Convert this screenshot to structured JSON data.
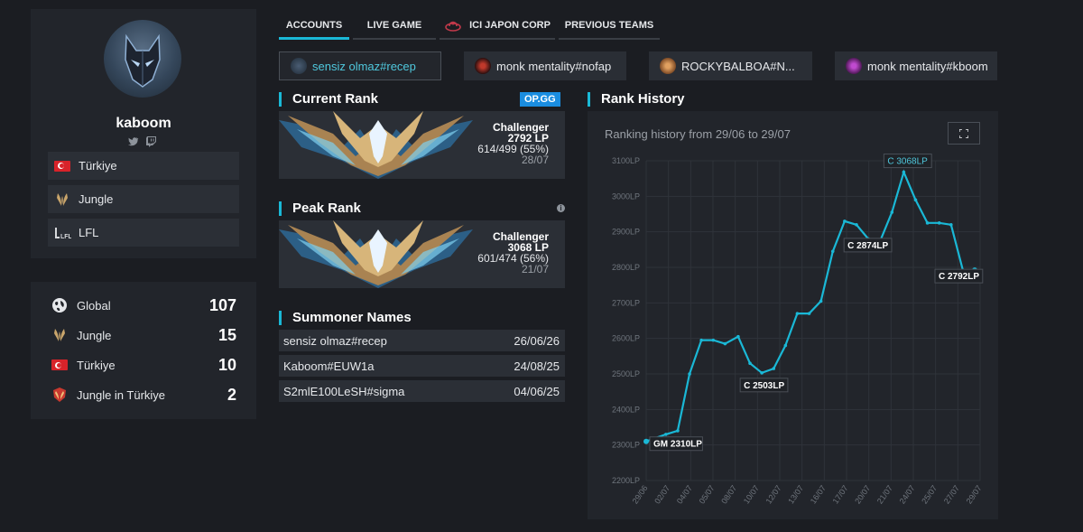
{
  "profile": {
    "name": "kaboom",
    "socials": [
      "twitter-icon",
      "twitch-icon"
    ],
    "info": [
      {
        "icon": "turkey-flag-icon",
        "label": "Türkiye"
      },
      {
        "icon": "jungle-role-icon",
        "label": "Jungle"
      },
      {
        "icon": "lfl-league-icon",
        "label": "LFL"
      }
    ]
  },
  "rankings": [
    {
      "icon": "globe-icon",
      "label": "Global",
      "value": "107"
    },
    {
      "icon": "jungle-role-icon",
      "label": "Jungle",
      "value": "15"
    },
    {
      "icon": "turkey-flag-icon",
      "label": "Türkiye",
      "value": "10"
    },
    {
      "icon": "jungle-turkey-crest-icon",
      "label": "Jungle in Türkiye",
      "value": "2"
    }
  ],
  "tabs": [
    "ACCOUNTS",
    "LIVE GAME",
    "ICI JAPON CORP",
    "PREVIOUS TEAMS"
  ],
  "accounts": [
    "sensiz olmaz#recep",
    "monk mentality#nofap",
    "ROCKYBALBOA#N...",
    "monk mentality#kboom"
  ],
  "colors": {
    "accent": "#1ab8d6",
    "opgg": "#1a8de0",
    "line": "#1ab8d6"
  },
  "current_rank": {
    "heading": "Current Rank",
    "badge": "OP.GG",
    "tier": "Challenger",
    "lp": "2792 LP",
    "record": "614/499 (55%)",
    "date": "28/07"
  },
  "peak_rank": {
    "heading": "Peak Rank",
    "tier": "Challenger",
    "lp": "3068 LP",
    "record": "601/474 (56%)",
    "date": "21/07"
  },
  "summoner_names": {
    "heading": "Summoner Names",
    "rows": [
      {
        "name": "sensiz olmaz#recep",
        "date": "26/06/26"
      },
      {
        "name": "Kaboom#EUW1a",
        "date": "24/08/25"
      },
      {
        "name": "S2mlE100LeSH#sigma",
        "date": "04/06/25"
      }
    ]
  },
  "rank_history": {
    "heading": "Rank History",
    "subtitle": "Ranking history from 29/06 to 29/07"
  },
  "chart_data": {
    "type": "line",
    "y_tick_labels": [
      "3100LP",
      "3000LP",
      "2900LP",
      "2800LP",
      "2700LP",
      "2600LP",
      "2500LP",
      "2400LP",
      "2300LP",
      "2200LP"
    ],
    "ylim": [
      2200,
      3100
    ],
    "x_tick_labels": [
      "29/06",
      "02/07",
      "04/07",
      "05/07",
      "08/07",
      "10/07",
      "12/07",
      "13/07",
      "16/07",
      "17/07",
      "20/07",
      "21/07",
      "24/07",
      "25/07",
      "27/07",
      "29/07"
    ],
    "grid": true,
    "series": [
      {
        "values": [
          [
            0,
            2310
          ],
          [
            1.5,
            2330
          ],
          [
            2.4,
            2340
          ],
          [
            3.3,
            2500
          ],
          [
            4.2,
            2595
          ],
          [
            5.1,
            2595
          ],
          [
            6.0,
            2585
          ],
          [
            7.0,
            2605
          ],
          [
            7.9,
            2530
          ],
          [
            8.8,
            2503
          ],
          [
            9.7,
            2515
          ],
          [
            10.6,
            2580
          ],
          [
            11.5,
            2670
          ],
          [
            12.4,
            2670
          ],
          [
            13.3,
            2705
          ],
          [
            14.2,
            2845
          ],
          [
            15.1,
            2930
          ],
          [
            16.0,
            2920
          ],
          [
            16.9,
            2880
          ],
          [
            17.8,
            2874
          ],
          [
            18.7,
            2955
          ],
          [
            19.6,
            3068
          ],
          [
            20.5,
            2990
          ],
          [
            21.4,
            2925
          ],
          [
            22.3,
            2925
          ],
          [
            23.2,
            2920
          ],
          [
            24.1,
            2792
          ],
          [
            25.0,
            2792
          ]
        ]
      }
    ],
    "annotations": [
      {
        "text": "GM 2310LP",
        "x": 0,
        "y": 2310
      },
      {
        "text": "C 2503LP",
        "x": 8.8,
        "y": 2503
      },
      {
        "text": "C 3068LP",
        "x": 19.6,
        "y": 3068
      },
      {
        "text": "C 2874LP",
        "x": 17.8,
        "y": 2874
      },
      {
        "text": "C 2792LP",
        "x": 25.0,
        "y": 2792
      }
    ]
  }
}
